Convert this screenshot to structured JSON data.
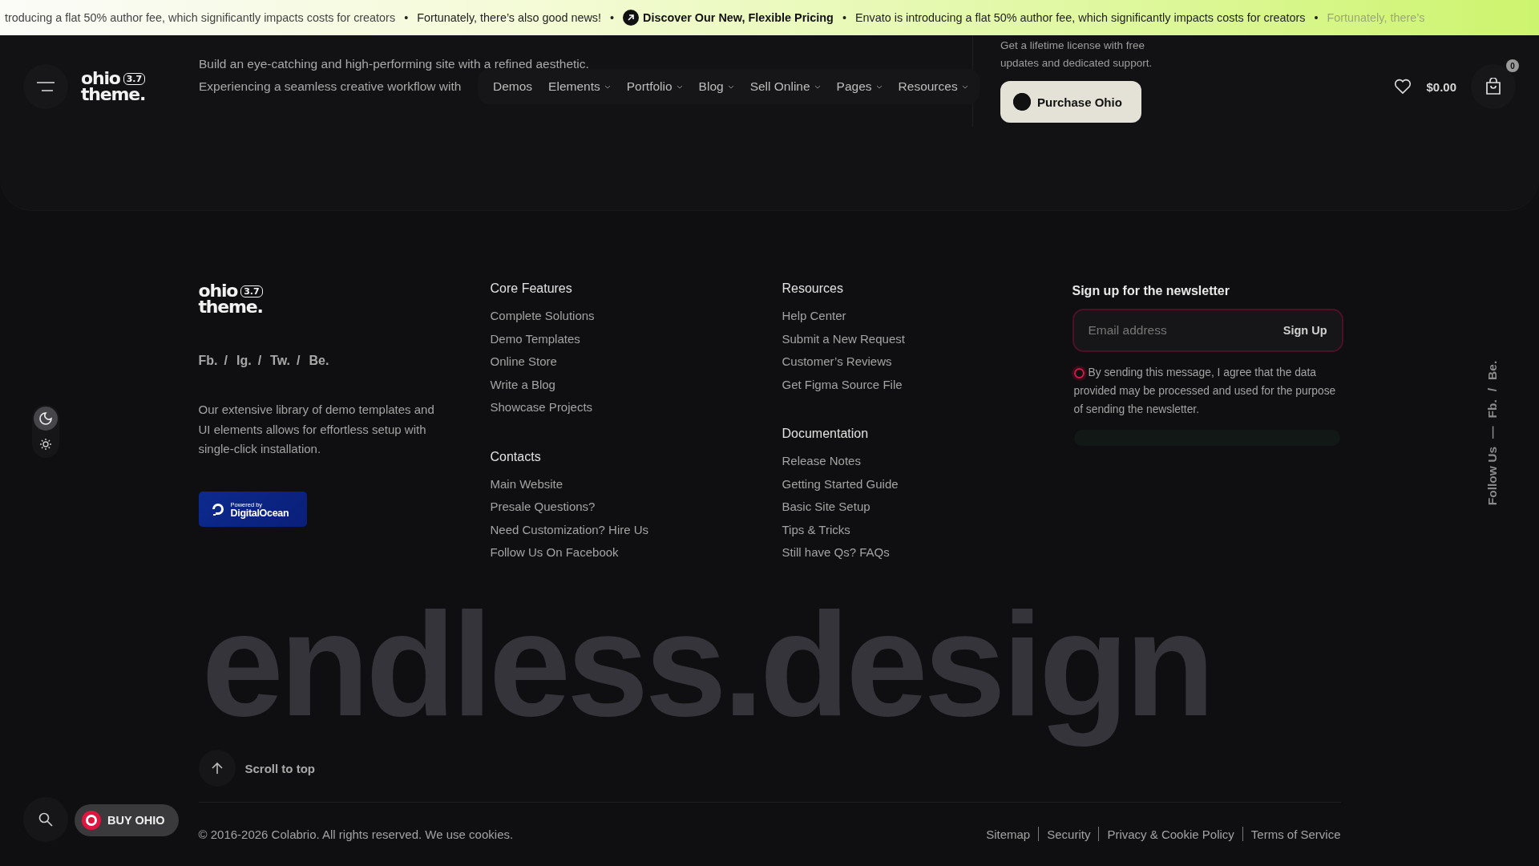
{
  "ticker": {
    "items": [
      {
        "kind": "text",
        "text": "troducing a flat 50% author fee, which significantly impacts costs for creators"
      },
      {
        "kind": "separator",
        "text": "•"
      },
      {
        "kind": "text",
        "text": "Fortunately, there’s also good news!"
      },
      {
        "kind": "separator",
        "text": "•"
      },
      {
        "kind": "link",
        "text": "Discover Our New, Flexible Pricing"
      },
      {
        "kind": "separator",
        "text": "•"
      },
      {
        "kind": "text",
        "text": "Envato is introducing a flat 50% author fee, which significantly impacts costs for creators"
      },
      {
        "kind": "separator",
        "text": "•"
      },
      {
        "kind": "faded",
        "text": "Fortunately, there’s"
      }
    ]
  },
  "hero": {
    "lines": [
      "Build an eye-catching and high-performing site with a refined aesthetic.",
      "Experiencing a seamless creative workflow with"
    ],
    "offer_lines": [
      "Get a lifetime license with free",
      "updates and dedicated support."
    ],
    "button": "Purchase Ohio"
  },
  "header": {
    "logo": {
      "line1": "ohio",
      "line2": "theme.",
      "version": "3.7"
    },
    "nav": [
      {
        "label": "Demos",
        "has_dropdown": false
      },
      {
        "label": "Elements",
        "has_dropdown": true
      },
      {
        "label": "Portfolio",
        "has_dropdown": true
      },
      {
        "label": "Blog",
        "has_dropdown": true
      },
      {
        "label": "Sell Online",
        "has_dropdown": true
      },
      {
        "label": "Pages",
        "has_dropdown": true
      },
      {
        "label": "Resources",
        "has_dropdown": true
      }
    ],
    "cart_total": "$0.00",
    "cart_count": "0"
  },
  "footer": {
    "logo": {
      "line1": "ohio",
      "line2": "theme.",
      "version": "3.7"
    },
    "socials": {
      "separator": "/",
      "links": [
        "Fb.",
        "Ig.",
        "Tw.",
        "Be."
      ]
    },
    "description": "Our extensive library of demo templates and UI elements allows for effortless setup with single-click installation.",
    "badge": {
      "small": "Powered by",
      "name": "DigitalOcean"
    },
    "columns": [
      [
        {
          "heading": "Core Features",
          "links": [
            "Complete Solutions",
            "Demo Templates",
            "Online Store",
            "Write a Blog",
            "Showcase Projects"
          ]
        },
        {
          "heading": "Contacts",
          "links": [
            "Main Website",
            "Presale Questions?",
            "Need Customization? Hire Us",
            "Follow Us On Facebook"
          ]
        }
      ],
      [
        {
          "heading": "Resources",
          "links": [
            "Help Center",
            "Submit a New Request",
            "Customer’s Reviews",
            "Get Figma Source File"
          ]
        },
        {
          "heading": "Documentation",
          "links": [
            "Release Notes",
            "Getting Started Guide",
            "Basic Site Setup",
            "Tips & Tricks",
            "Still have Qs? FAQs"
          ]
        }
      ]
    ],
    "newsletter": {
      "heading": "Sign up for the newsletter",
      "placeholder": "Email address",
      "button": "Sign Up",
      "invalid": true,
      "consent": {
        "text": "By sending this message, I agree that the data provided may be processed and used for the purpose of sending the newsletter.",
        "checked": false
      }
    },
    "watermark": "endless.design",
    "scroll_top": "Scroll to top",
    "copyright": "© 2016-2026 Colabrio. All rights reserved. We use cookies.",
    "legal_links": [
      "Sitemap",
      "Security",
      "Privacy & Cookie Policy",
      "Terms of Service"
    ]
  },
  "follow_us": {
    "label": "Follow Us",
    "dash": "—",
    "separator": "/",
    "links": [
      "Fb.",
      "Be."
    ]
  },
  "theme_toggle": {
    "options": [
      {
        "kind": "dark",
        "selected": true
      },
      {
        "kind": "light",
        "selected": false
      }
    ]
  },
  "floating": {
    "buy_button": "BUY OHIO"
  }
}
